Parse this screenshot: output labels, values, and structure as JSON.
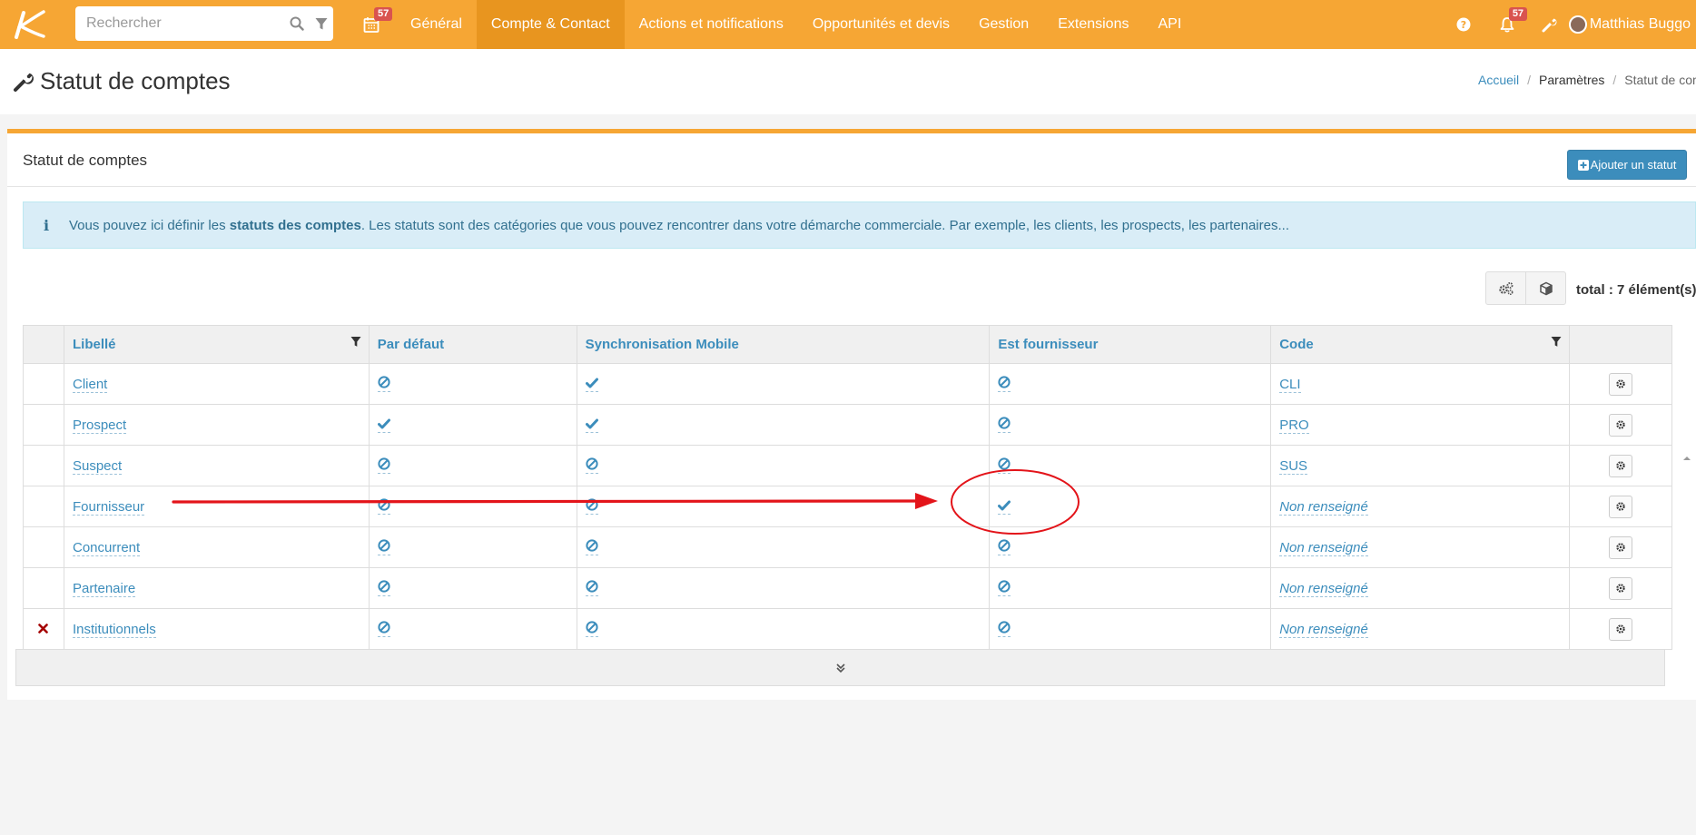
{
  "topbar": {
    "search_placeholder": "Rechercher",
    "calendar_badge": "57",
    "nav": [
      {
        "label": "Général",
        "active": false
      },
      {
        "label": "Compte & Contact",
        "active": true
      },
      {
        "label": "Actions et notifications",
        "active": false
      },
      {
        "label": "Opportunités et devis",
        "active": false
      },
      {
        "label": "Gestion",
        "active": false
      },
      {
        "label": "Extensions",
        "active": false
      },
      {
        "label": "API",
        "active": false
      }
    ],
    "notif_badge": "57",
    "user_name": "Matthias Buggo",
    "accent_color": "#f6a634"
  },
  "page": {
    "title": "Statut de comptes",
    "breadcrumb": {
      "home": "Accueil",
      "parent": "Paramètres",
      "current": "Statut de comptes"
    }
  },
  "box": {
    "title": "Statut de comptes",
    "add_button": "Ajouter un statut",
    "info_before": "Vous pouvez ici définir les ",
    "info_bold": "statuts des comptes",
    "info_after": ". Les statuts sont des catégories que vous pouvez rencontrer dans votre démarche commerciale. Par exemple, les clients, les prospects, les partenaires...",
    "total": "total : 7 élément(s)"
  },
  "table": {
    "headers": {
      "label": "Libellé",
      "default": "Par défaut",
      "sync": "Synchronisation Mobile",
      "supplier": "Est fournisseur",
      "code": "Code"
    },
    "rows": [
      {
        "label": "Client",
        "default": "no",
        "sync": "yes",
        "supplier": "no",
        "code": "CLI",
        "code_set": true,
        "deletable": false
      },
      {
        "label": "Prospect",
        "default": "yes",
        "sync": "yes",
        "supplier": "no",
        "code": "PRO",
        "code_set": true,
        "deletable": false
      },
      {
        "label": "Suspect",
        "default": "no",
        "sync": "no",
        "supplier": "no",
        "code": "SUS",
        "code_set": true,
        "deletable": false
      },
      {
        "label": "Fournisseur",
        "default": "no",
        "sync": "no",
        "supplier": "yes",
        "code": "Non renseigné",
        "code_set": false,
        "deletable": false
      },
      {
        "label": "Concurrent",
        "default": "no",
        "sync": "no",
        "supplier": "no",
        "code": "Non renseigné",
        "code_set": false,
        "deletable": false
      },
      {
        "label": "Partenaire",
        "default": "no",
        "sync": "no",
        "supplier": "no",
        "code": "Non renseigné",
        "code_set": false,
        "deletable": false
      },
      {
        "label": "Institutionnels",
        "default": "no",
        "sync": "no",
        "supplier": "no",
        "code": "Non renseigné",
        "code_set": false,
        "deletable": true
      }
    ]
  },
  "icons": {
    "yes": "check-icon",
    "no": "ban-icon",
    "delete": "times-icon",
    "row_action": "cog-icon"
  },
  "annotation_color": "#e3141a"
}
